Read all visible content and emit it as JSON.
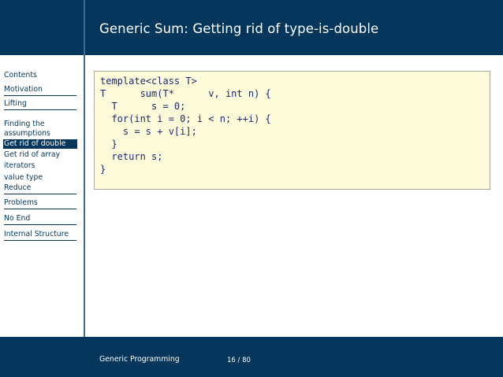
{
  "slide": {
    "title": "Generic Sum: Getting rid of type-is-double"
  },
  "sidebar": {
    "items": [
      {
        "label": "Contents"
      },
      {
        "label": "Motivation"
      },
      {
        "label": "Lifting"
      },
      {
        "label": "Finding the"
      },
      {
        "label": "assumptions"
      },
      {
        "label": "Get rid of double"
      },
      {
        "label": "Get rid of array"
      },
      {
        "label": "iterators"
      },
      {
        "label": "value type"
      },
      {
        "label": "Reduce"
      },
      {
        "label": "Problems"
      },
      {
        "label": "No End"
      },
      {
        "label": "Internal Structure"
      }
    ]
  },
  "code": {
    "lines": [
      "template<class T>",
      "T      sum(T*      v, int n) {",
      "  T      s = 0;",
      "  for(int i = 0; i < n; ++i) {",
      "    s = s + v[i];",
      "  }",
      "  return s;",
      "}"
    ]
  },
  "footer": {
    "left": "Generic Programming",
    "page": "16 / 80"
  },
  "colors": {
    "bar": "#04365c",
    "code_bg": "#fdfbd9",
    "code_text": "#1c2a6e"
  }
}
